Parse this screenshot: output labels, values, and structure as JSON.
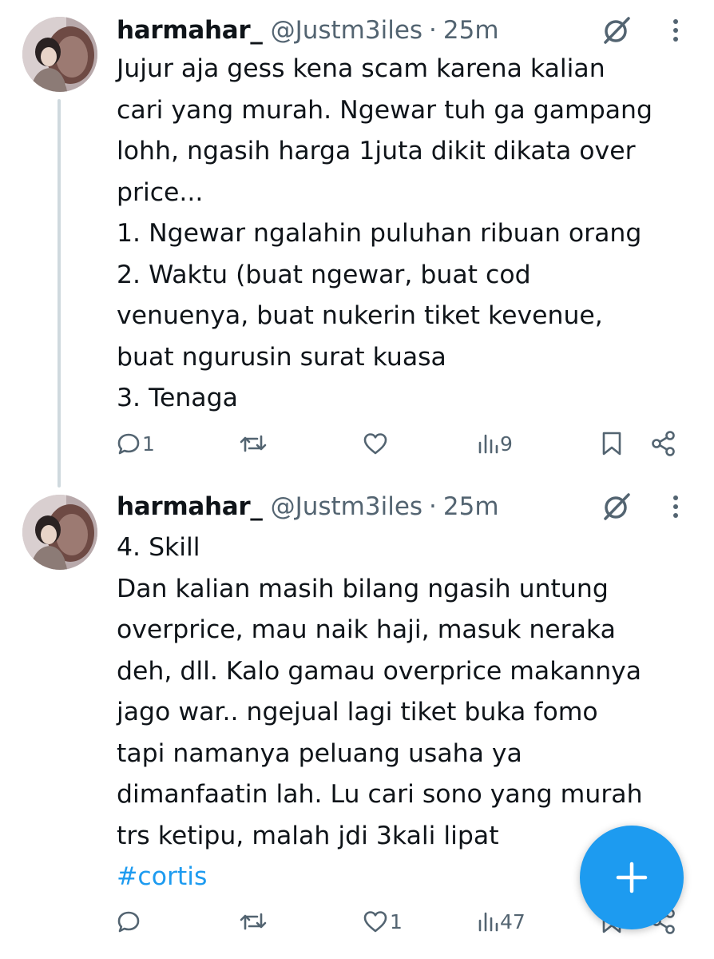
{
  "posts": [
    {
      "author_name": "harmahar_",
      "author_handle": "@Justm3iles",
      "separator": "·",
      "time": "25m",
      "text_lines": [
        "Jujur aja gess kena scam karena kalian",
        "cari yang murah. Ngewar tuh ga gampang",
        "lohh, ngasih harga 1juta dikit dikata over",
        "price...",
        "1. Ngewar ngalahin puluhan ribuan orang",
        "2. Waktu (buat ngewar, buat cod",
        "venuenya, buat nukerin tiket kevenue,",
        "buat ngurusin surat kuasa",
        "3. Tenaga"
      ],
      "reply_count": "1",
      "repost_count": "",
      "like_count": "",
      "view_count": "9"
    },
    {
      "author_name": "harmahar_",
      "author_handle": "@Justm3iles",
      "separator": "·",
      "time": "25m",
      "text_lines": [
        "4. Skill",
        "Dan kalian masih bilang ngasih untung",
        "overprice, mau naik haji, masuk neraka",
        "deh, dll. Kalo gamau overprice makannya",
        "jago war.. ngejual lagi tiket buka fomo",
        "tapi namanya peluang usaha ya",
        "dimanfaatin lah. Lu cari sono yang murah",
        "trs ketipu, malah jdi 3kali lipat"
      ],
      "hashtag": "#cortis",
      "reply_count": "",
      "repost_count": "",
      "like_count": "1",
      "view_count": "47"
    }
  ],
  "icons": {
    "grok": "grok-icon",
    "more": "more-vertical-icon",
    "reply": "reply-icon",
    "repost": "repost-icon",
    "like": "like-icon",
    "views": "views-icon",
    "bookmark": "bookmark-icon",
    "share": "share-icon",
    "compose": "plus-icon"
  },
  "colors": {
    "accent": "#1d9bf0",
    "text": "#0f1419",
    "secondary": "#536471",
    "thread_line": "#cfd9de"
  }
}
